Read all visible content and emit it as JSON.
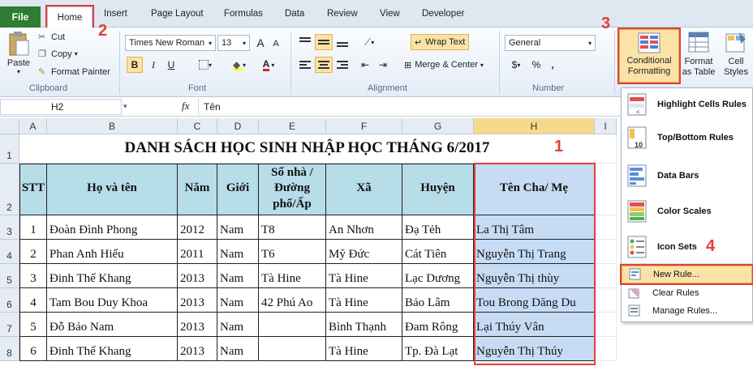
{
  "tabs": {
    "file": "File",
    "home": "Home",
    "insert": "Insert",
    "page_layout": "Page Layout",
    "formulas": "Formulas",
    "data": "Data",
    "review": "Review",
    "view": "View",
    "developer": "Developer"
  },
  "clipboard": {
    "paste": "Paste",
    "cut": "Cut",
    "copy": "Copy",
    "format_painter": "Format Painter",
    "group": "Clipboard"
  },
  "font": {
    "name": "Times New Roman",
    "size": "13",
    "grow": "A",
    "shrink": "A",
    "bold": "B",
    "italic": "I",
    "underline": "U",
    "font_color": "A",
    "group": "Font"
  },
  "alignment": {
    "wrap_text": "Wrap Text",
    "merge_center": "Merge & Center",
    "group": "Alignment"
  },
  "number": {
    "format": "General",
    "currency": "$",
    "percent": "%",
    "comma": ",",
    "group": "Number"
  },
  "styles": {
    "conditional_formatting": "Conditional Formatting",
    "format_as_table": "Format as Table",
    "cell_styles": "Cell Styles"
  },
  "formula_bar": {
    "name_box": "H2",
    "fx": "fx",
    "value": "Tên"
  },
  "steps": {
    "s1": "1",
    "s2": "2",
    "s3": "3",
    "s4": "4"
  },
  "columns": [
    "A",
    "B",
    "C",
    "D",
    "E",
    "F",
    "G",
    "H",
    "I"
  ],
  "rows": [
    "1",
    "2",
    "3",
    "4",
    "5",
    "6",
    "7",
    "8"
  ],
  "sheet": {
    "title": "DANH SÁCH HỌC SINH NHẬP HỌC THÁNG 6/2017",
    "headers": [
      "STT",
      "Họ và tên",
      "Năm",
      "Giới",
      "Số nhà /Đường phố/Ấp",
      "Xã",
      "Huyện",
      "Tên Cha/ Mẹ"
    ],
    "data": [
      [
        "1",
        "Đoàn Đình Phong",
        "2012",
        "Nam",
        "T8",
        "An Nhơn",
        "Đạ Tẻh",
        "La Thị Tâm"
      ],
      [
        "2",
        "Phan Anh Hiếu",
        "2011",
        "Nam",
        "T6",
        "Mỹ Đức",
        "Cát Tiên",
        "Nguyễn Thị Trang"
      ],
      [
        "3",
        "Đinh Thế Khang",
        "2013",
        "Nam",
        "Tà Hine",
        "Tà Hine",
        "Lạc Dương",
        "Nguyễn Thị thùy"
      ],
      [
        "4",
        "Tam Bou Duy Khoa",
        "2013",
        "Nam",
        "42 Phú Ao",
        "Tà Hine",
        "Bảo Lâm",
        "Tou Brong Dăng Du"
      ],
      [
        "5",
        "Đỗ Bảo Nam",
        "2013",
        "Nam",
        "",
        "Bình Thạnh",
        "Đam Rông",
        "Lại Thúy Vân"
      ],
      [
        "6",
        "Đinh Thế Khang",
        "2013",
        "Nam",
        "",
        "Tà Hine",
        "Tp. Đà Lạt",
        "Nguyễn Thị Thúy"
      ]
    ]
  },
  "menu": {
    "highlight": "Highlight Cells Rules",
    "topbottom": "Top/Bottom Rules",
    "databars": "Data Bars",
    "colorscales": "Color Scales",
    "iconsets": "Icon Sets",
    "newrule": "New Rule...",
    "clearrules": "Clear Rules",
    "managerules": "Manage Rules..."
  },
  "colors": {
    "accent": "#e0403a",
    "file_tab": "#2e7d32",
    "header_fill": "#b7dde8",
    "selection": "#c6dcf5"
  }
}
